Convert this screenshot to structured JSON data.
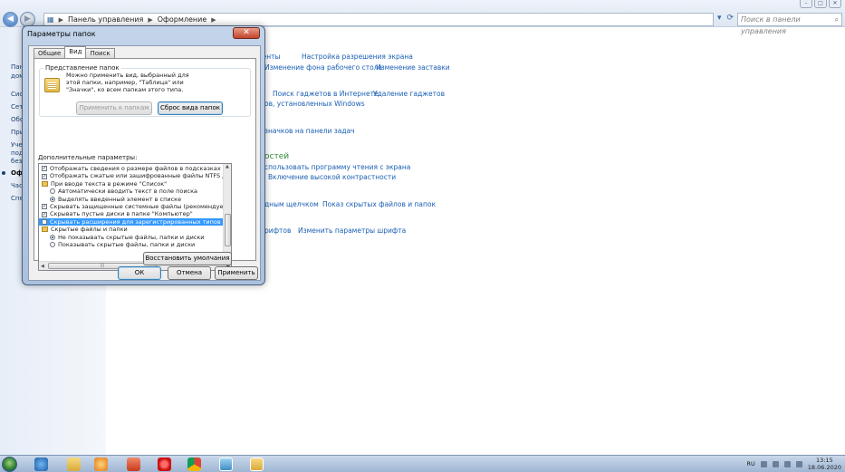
{
  "explorer": {
    "address": [
      "Панель управления",
      "Оформление"
    ],
    "search_placeholder": "Поиск в панели управления"
  },
  "left_pane": {
    "items": [
      "Пан",
      "дом",
      "Сис",
      "Сет",
      "Обо",
      "При",
      "Уче",
      "под",
      "без",
      "Оф",
      "Час",
      "Спе"
    ],
    "active_index": 9
  },
  "cp_links": {
    "row1": [
      "Настройка разрешения экрана"
    ],
    "row1_partial": "менты",
    "row2_partial": "Изменение фона рабочего стола",
    "row2b": "Изменение заставки",
    "row3": [
      "Поиск гаджетов в Интернете",
      "Удаление гаджетов"
    ],
    "row4_partial": "ов, установленных Windows",
    "row5_partial": "значков на панели задач",
    "heading_partial": "остей",
    "row6_partial": "спользовать программу чтения с экрана",
    "row7_partial": "Включение высокой контрастности",
    "row8_partial": "дным щелчком",
    "row8b": "Показ скрытых файлов и папок",
    "row9_partial": "рифтов",
    "row9b": "Изменить параметры шрифта"
  },
  "dialog": {
    "title": "Параметры папок",
    "close_glyph": "✕",
    "tabs": [
      "Общие",
      "Вид",
      "Поиск"
    ],
    "active_tab": 1,
    "group_label": "Представление папок",
    "group_text": "Можно применить вид, выбранный для этой папки, например, \"Таблица\" или \"Значки\", ко всем папкам этого типа.",
    "apply_to_folders": "Применить к папкам",
    "reset_folders": "Сброс вида папок",
    "advanced_label": "Дополнительные параметры:",
    "advanced_items": [
      {
        "type": "check",
        "checked": true,
        "text": "Отображать сведения о размере файлов в подсказках папок",
        "indent": 0
      },
      {
        "type": "check",
        "checked": true,
        "text": "Отображать сжатые или зашифрованные файлы NTFS другим цветом",
        "indent": 0
      },
      {
        "type": "folder",
        "text": "При вводе текста в режиме \"Список\"",
        "indent": 0
      },
      {
        "type": "radio",
        "checked": false,
        "text": "Автоматически вводить текст в поле поиска",
        "indent": 1
      },
      {
        "type": "radio",
        "checked": true,
        "text": "Выделять введенный элемент в списке",
        "indent": 1
      },
      {
        "type": "check",
        "checked": true,
        "text": "Скрывать защищенные системные файлы (рекомендуется)",
        "indent": 0
      },
      {
        "type": "check",
        "checked": true,
        "text": "Скрывать пустые диски в папке \"Компьютер\"",
        "indent": 0
      },
      {
        "type": "check",
        "checked": false,
        "text": "Скрывать расширения для зарегистрированных типов файлов",
        "indent": 0,
        "selected": true
      },
      {
        "type": "folder",
        "text": "Скрытые файлы и папки",
        "indent": 0
      },
      {
        "type": "radio",
        "checked": true,
        "text": "Не показывать скрытые файлы, папки и диски",
        "indent": 1
      },
      {
        "type": "radio",
        "checked": false,
        "text": "Показывать скрытые файлы, папки и диски",
        "indent": 1
      }
    ],
    "restore_defaults": "Восстановить умолчания",
    "ok": "ОК",
    "cancel": "Отмена",
    "apply": "Применить"
  },
  "taskbar": {
    "lang": "RU",
    "time": "13:15",
    "date": "18.06.2020"
  },
  "colors": {
    "link": "#1a5fb4",
    "selection": "#3399ff",
    "heading_green": "#2f8a3a"
  }
}
